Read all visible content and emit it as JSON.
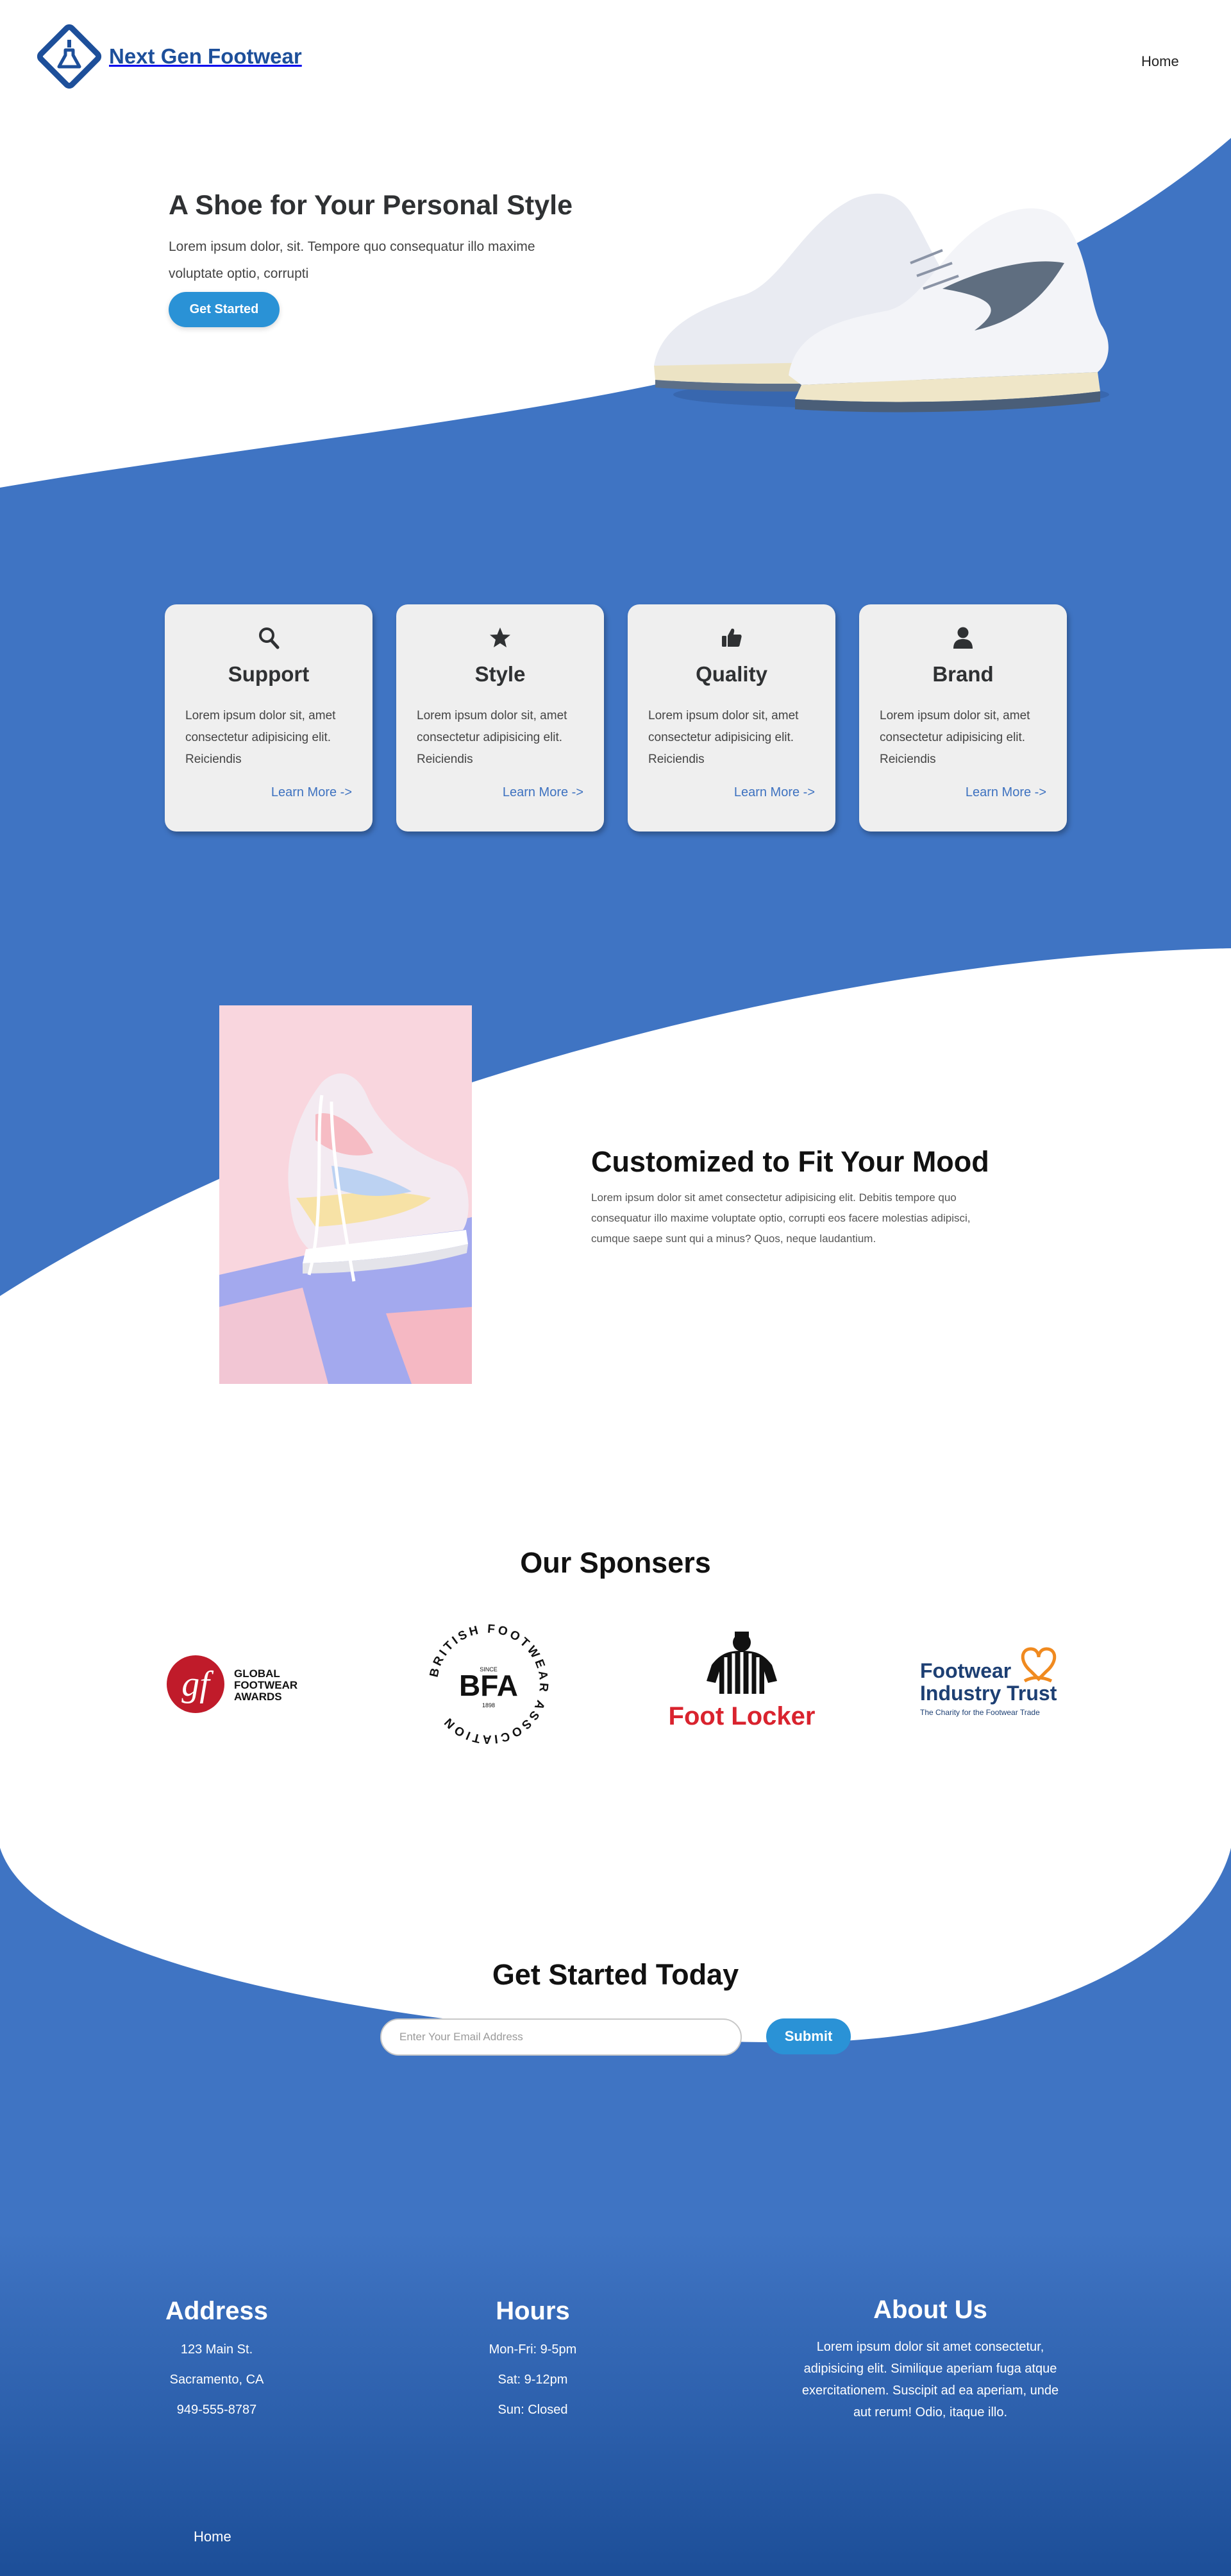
{
  "header": {
    "brand": "Next Gen Footwear",
    "nav_home": "Home"
  },
  "hero": {
    "title": "A Shoe for Your Personal Style",
    "text": "Lorem ipsum dolor, sit. Tempore quo consequatur illo maxime voluptate optio, corrupti",
    "button": "Get Started"
  },
  "features": [
    {
      "icon": "search-icon",
      "title": "Support",
      "text": "Lorem ipsum dolor sit, amet consectetur adipisicing elit. Reiciendis",
      "link": "Learn More ->"
    },
    {
      "icon": "star-icon",
      "title": "Style",
      "text": "Lorem ipsum dolor sit, amet consectetur adipisicing elit. Reiciendis",
      "link": "Learn More ->"
    },
    {
      "icon": "thumbs-up-icon",
      "title": "Quality",
      "text": "Lorem ipsum dolor sit, amet consectetur adipisicing elit. Reiciendis",
      "link": "Learn More ->"
    },
    {
      "icon": "user-icon",
      "title": "Brand",
      "text": "Lorem ipsum dolor sit, amet consectetur adipisicing elit. Reiciendis",
      "link": "Learn More ->"
    }
  ],
  "mood": {
    "title": "Customized to Fit Your Mood",
    "text": "Lorem ipsum dolor sit amet consectetur adipisicing elit. Debitis tempore quo consequatur illo maxime voluptate optio, corrupti eos facere molestias adipisci, cumque saepe sunt qui a minus? Quos, neque laudantium."
  },
  "sponsors": {
    "title": "Our Sponsers",
    "items": [
      {
        "name": "GLOBAL FOOTWEAR AWARDS",
        "line1": "GLOBAL",
        "line2": "FOOTWEAR",
        "line3": "AWARDS"
      },
      {
        "name": "BFA",
        "ring_text": "BRITISH FOOTWEAR ASSOCIATION",
        "since": "SINCE",
        "year": "1898"
      },
      {
        "name": "Foot Locker"
      },
      {
        "name": "Footwear Industry Trust",
        "line1": "Footwear",
        "line2": "Industry Trust",
        "tagline": "The Charity for the Footwear Trade"
      }
    ]
  },
  "get_started": {
    "title": "Get Started Today",
    "placeholder": "Enter Your Email Address",
    "button": "Submit"
  },
  "footer": {
    "address": {
      "title": "Address",
      "lines": [
        "123 Main St.",
        "Sacramento, CA",
        "949-555-8787"
      ]
    },
    "hours": {
      "title": "Hours",
      "lines": [
        "Mon-Fri: 9-5pm",
        "Sat: 9-12pm",
        "Sun: Closed"
      ]
    },
    "about": {
      "title": "About Us",
      "text": "Lorem ipsum dolor sit amet consectetur, adipisicing elit. Similique aperiam fuga atque exercitationem. Suscipit ad ea aperiam, unde aut rerum! Odio, itaque illo."
    },
    "home": "Home"
  },
  "colors": {
    "primary_blue": "#3f74c3",
    "dark_blue": "#1d4f9a",
    "button_blue": "#2a92d6",
    "card_bg": "#efefef"
  }
}
